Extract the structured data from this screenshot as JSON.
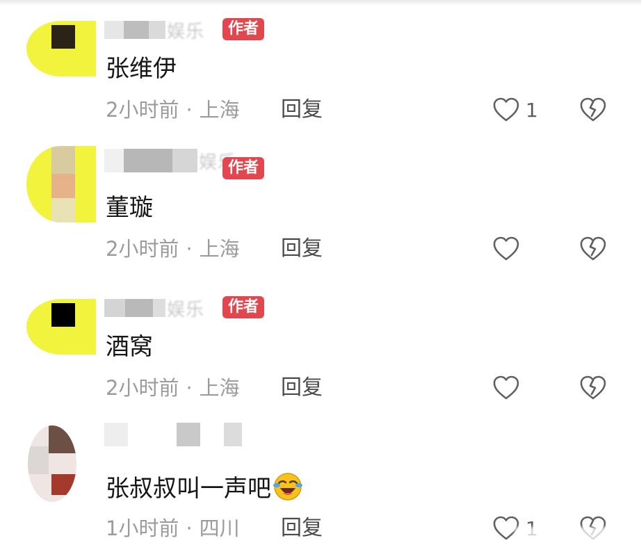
{
  "comments": [
    {
      "content": "张维伊",
      "author_tag": "作者",
      "name_suffix": "娱乐",
      "time": "2小时前",
      "location": "上海",
      "reply": "回复",
      "likes": "1"
    },
    {
      "content": "董璇",
      "author_tag": "作者",
      "name_suffix": "娱乐",
      "time": "2小时前",
      "location": "上海",
      "reply": "回复",
      "likes": ""
    },
    {
      "content": "酒窝",
      "author_tag": "作者",
      "name_suffix": "娱乐",
      "time": "2小时前",
      "location": "上海",
      "reply": "回复",
      "likes": ""
    },
    {
      "content": "张叔叔叫一声吧",
      "emoji": "laughing-crying-emoji",
      "time": "1小时前",
      "location": "四川",
      "reply": "回复",
      "likes": "1"
    }
  ],
  "meta_separator": "·",
  "icons": {
    "like": "heart-outline-icon",
    "dislike": "broken-heart-icon"
  },
  "colors": {
    "author_tag_bg": "#e2474f",
    "meta_text": "#9b9b9b",
    "content_text": "#161616"
  }
}
